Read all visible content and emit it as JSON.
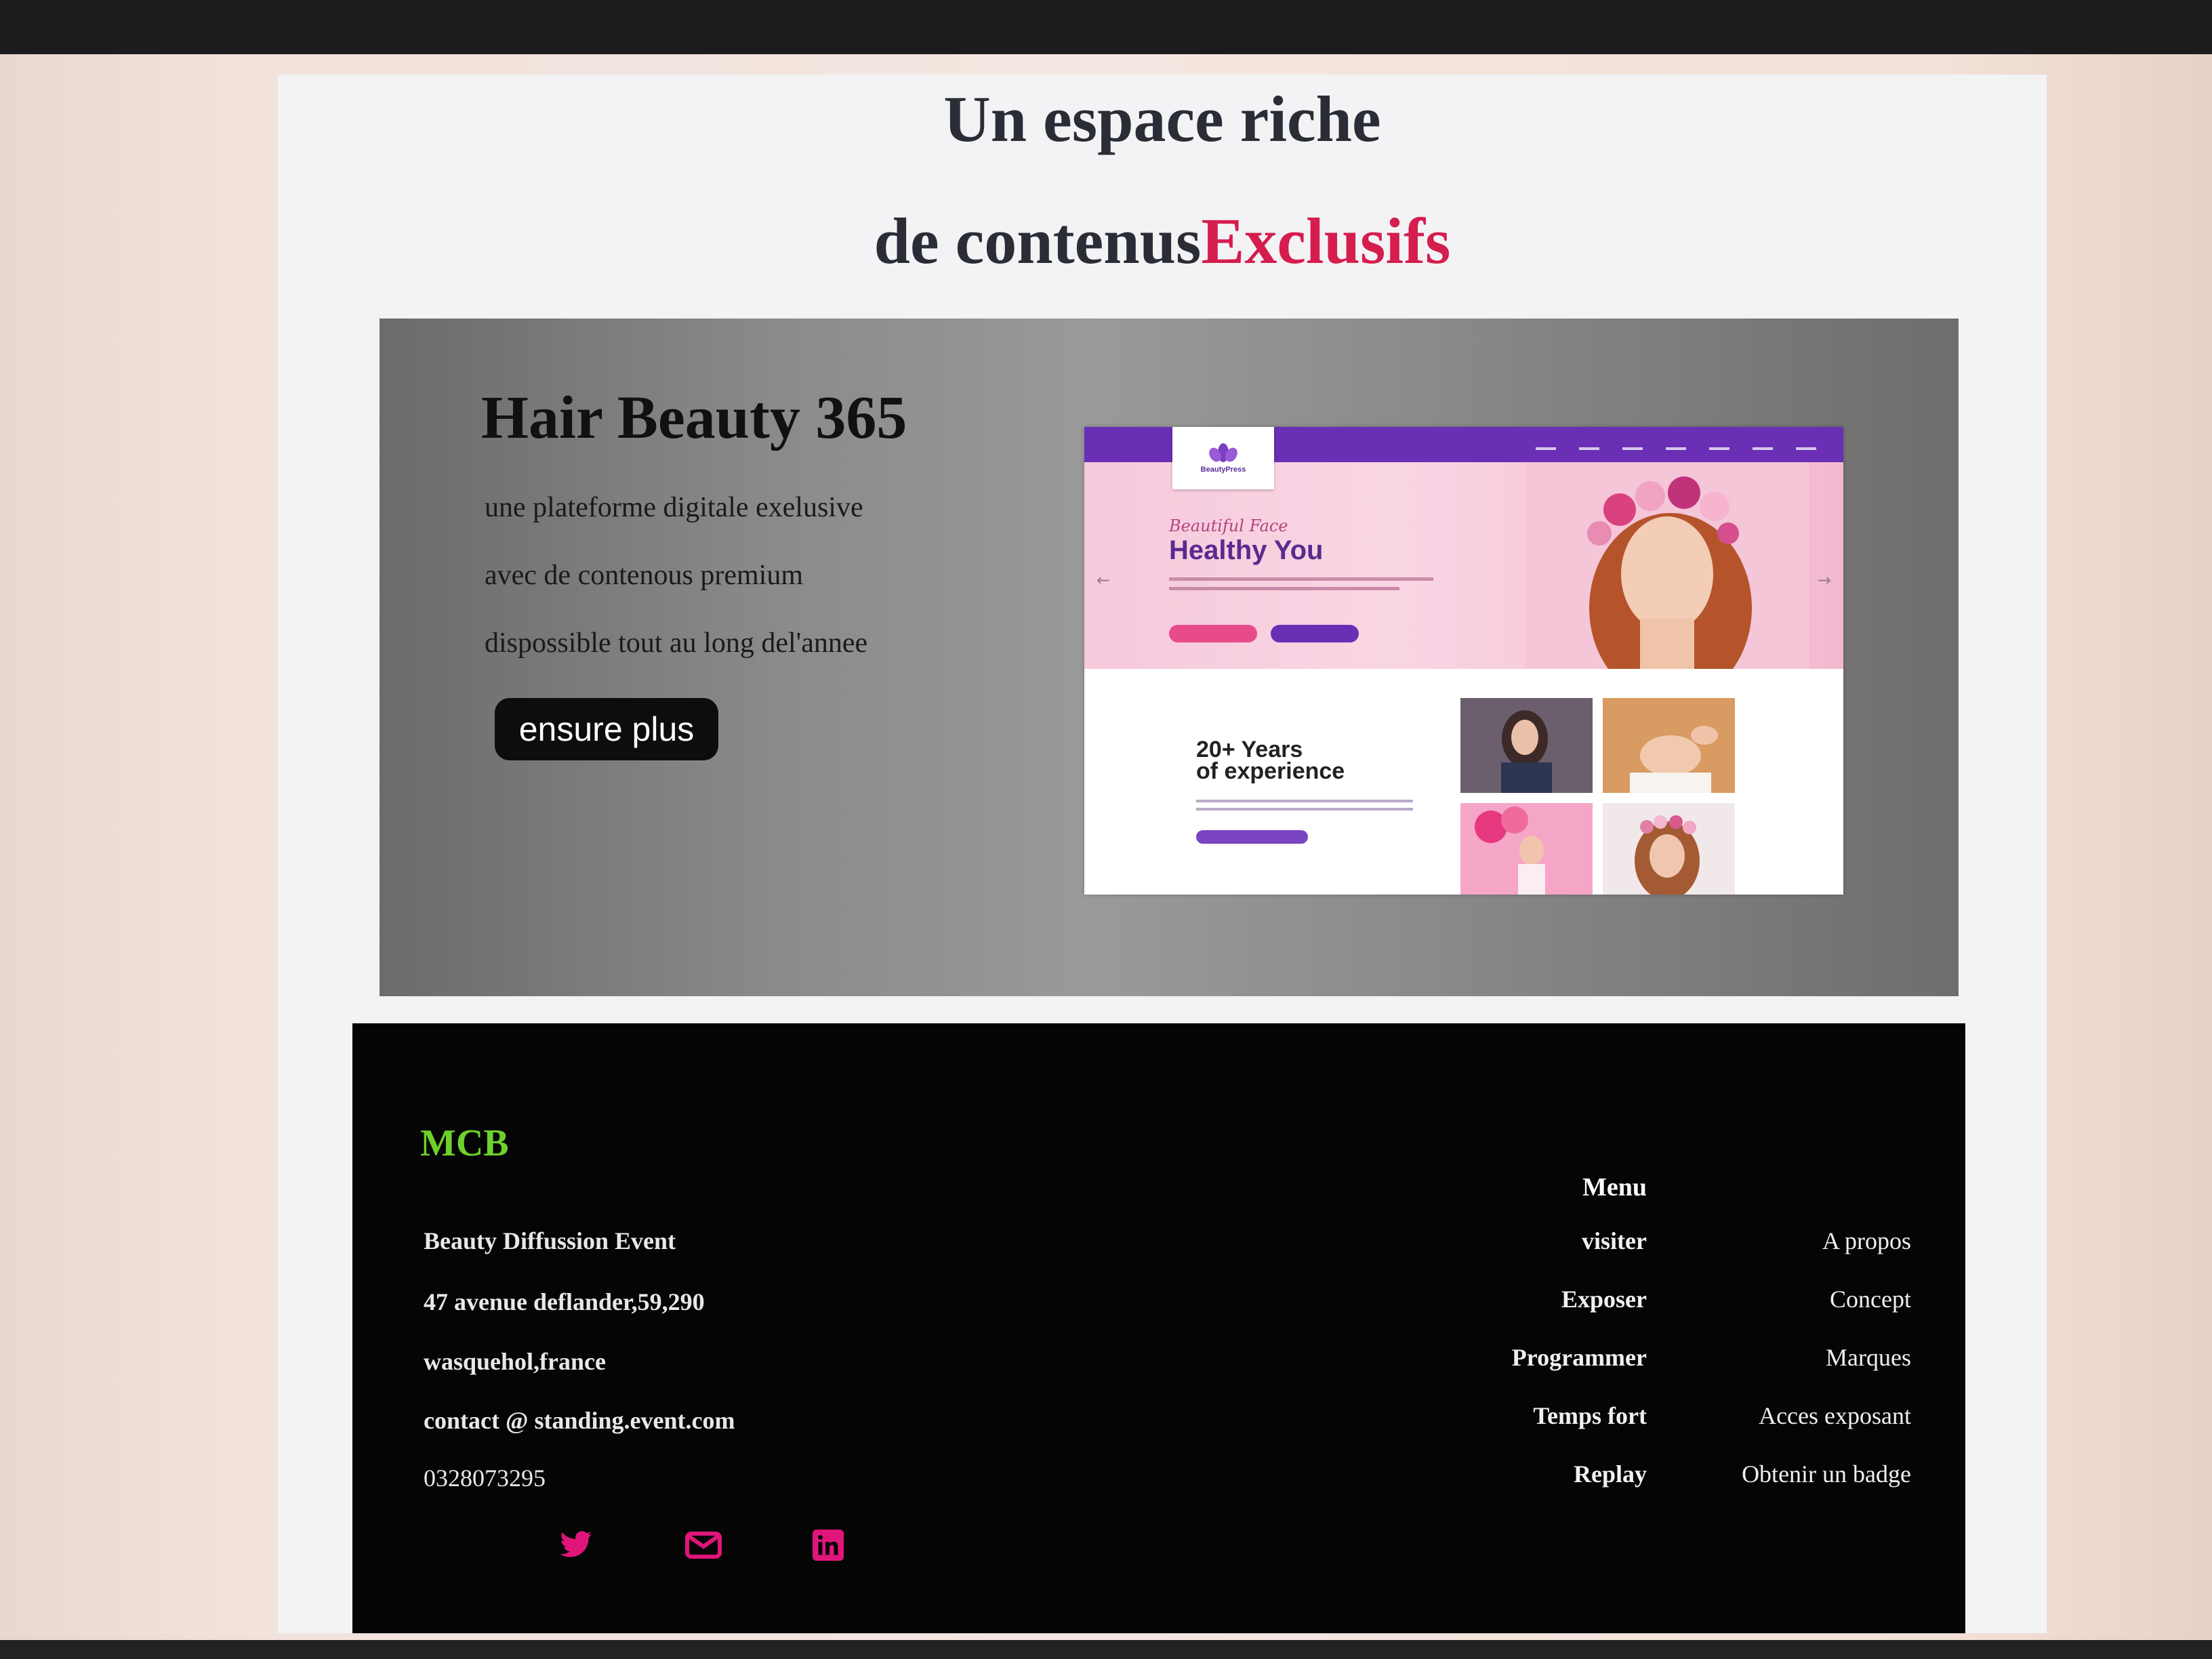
{
  "hero": {
    "line1": "Un espace riche",
    "line2_prefix": "de contenus",
    "line2_accent": "Exclusifs",
    "accent_color": "#d51d4e"
  },
  "feature": {
    "title": "Hair Beauty 365",
    "lines": [
      "une plateforme digitale exelusive",
      "avec de contenous premium",
      "dispossible tout au long del'annee"
    ],
    "button_label": "ensure plus",
    "preview": {
      "logo_text": "BeautyPress",
      "script_text": "Beautiful Face",
      "headline": "Healthy You",
      "years_line1": "20+ Years",
      "years_line2": "of experience"
    }
  },
  "footer": {
    "brand": "MCB",
    "brand_color": "#6fd12b",
    "company": "Beauty Diffussion Event",
    "address": "47 avenue deflander,59,290",
    "city": "wasquehol,france",
    "email": "contact @ standing.event.com",
    "phone": "0328073295",
    "social_icons": [
      "twitter-icon",
      "mail-icon",
      "linkedin-icon"
    ],
    "social_color": "#e0157a",
    "menu_title": "Menu",
    "menu_left": [
      "visiter",
      "Exposer",
      "Programmer",
      "Temps fort",
      "Replay"
    ],
    "menu_right": [
      "A propos",
      "Concept",
      "Marques",
      "Acces exposant",
      "Obtenir un badge"
    ]
  }
}
